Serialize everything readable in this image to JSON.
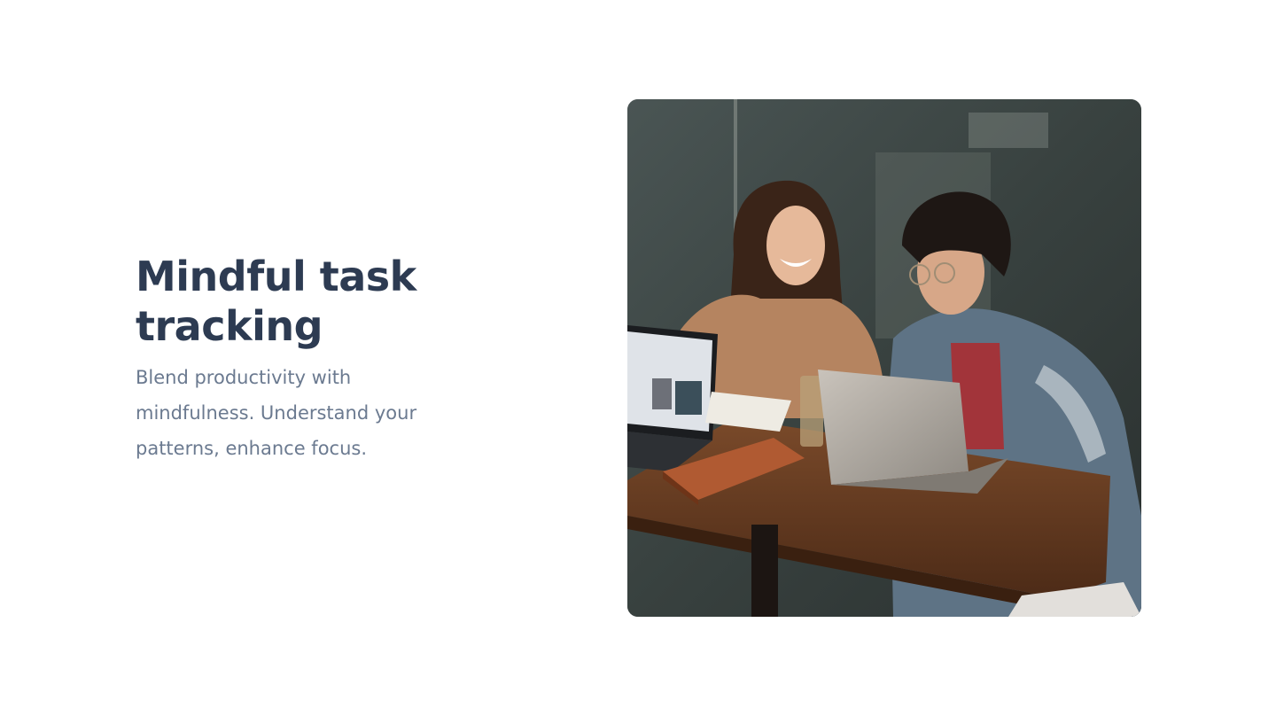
{
  "hero": {
    "title": "Mindful task tracking",
    "description": "Blend productivity with mindfulness. Understand your patterns, enhance focus."
  },
  "photo": {
    "alt": "two-people-laughing-at-laptops-in-cafe"
  },
  "colors": {
    "heading": "#2d3b52",
    "body_text": "#6b7a90",
    "background": "#ffffff"
  }
}
